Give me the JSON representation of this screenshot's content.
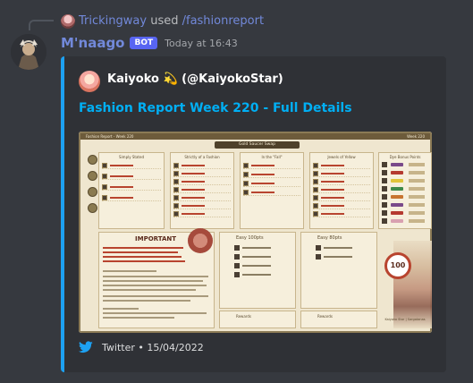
{
  "reply": {
    "username": "Trickingway",
    "used_text": "used",
    "command": "/fashionreport"
  },
  "author": {
    "name": "M'naago",
    "tag": "BOT",
    "timestamp": "Today at 16:43"
  },
  "embed": {
    "accent_color": "#1da1f2",
    "author": "Kaiyoko 💫 (@KaiyokoStar)",
    "title": "Fashion Report Week 220 - Full Details",
    "footer_icon": "twitter-icon",
    "footer": "Twitter • 15/04/2022",
    "image": {
      "header": "Gold Saucer Swap",
      "topbar_left": "Fashion Report - Week 220",
      "topbar_right": "Week 220",
      "panels": [
        "Simply Stated",
        "Strictly of a Fashion",
        "In the \"Fall\"",
        "Jewels of Yellow"
      ],
      "dye_title": "Dye Bonus Points",
      "important_title": "IMPORTANT",
      "easy_panels": [
        "Easy 100pts",
        "Easy 80pts"
      ],
      "rewards_label": "Rewards",
      "score": "100",
      "credit": "Kaiyoko Star | Sargatanas"
    }
  }
}
